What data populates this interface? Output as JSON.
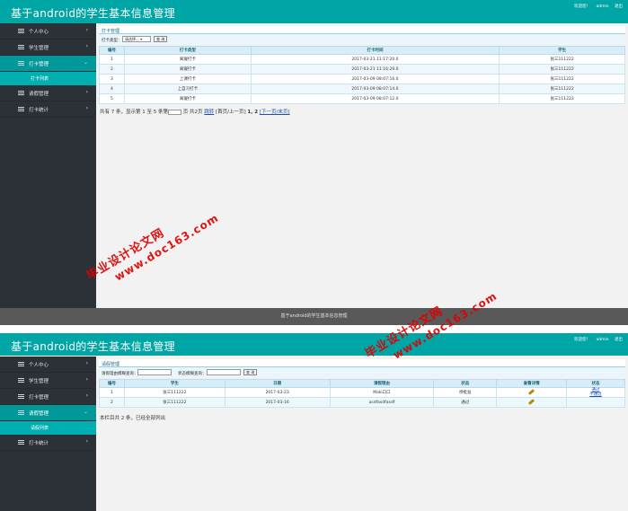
{
  "app_title": "基于android的学生基本信息管理",
  "header_links": {
    "greeting": "欢迎您！",
    "username": "admin",
    "logout": "退出"
  },
  "footer_text": "基于android的学生基本信息管理",
  "screen1": {
    "sidebar": {
      "items": [
        {
          "label": "个人中心",
          "arrow": "›"
        },
        {
          "label": "学生管理",
          "arrow": "›"
        },
        {
          "label": "打卡管理",
          "arrow": "⌄"
        },
        {
          "label": "请假管理",
          "arrow": "›"
        },
        {
          "label": "打卡统计",
          "arrow": "›"
        }
      ],
      "sub_item": "打卡列表"
    },
    "panel_title": "打卡管理",
    "filter": {
      "label": "打卡类型：",
      "select_value": "请选择...",
      "search_button": "查 询"
    },
    "table": {
      "headers": [
        "编号",
        "打卡类型",
        "打卡时间",
        "学生"
      ],
      "rows": [
        [
          "1",
          "离寝打卡",
          "2017-03-21 11:17:20.0",
          "张三111222"
        ],
        [
          "2",
          "离寝打卡",
          "2017-03-21 11:16:29.0",
          "张三111222"
        ],
        [
          "3",
          "上课打卡",
          "2017-03-09 08:07:16.0",
          "张三111222"
        ],
        [
          "4",
          "上自习打卡",
          "2017-03-09 08:07:14.0",
          "张三111222"
        ],
        [
          "5",
          "离寝打卡",
          "2017-03-09 08:07:12.0",
          "张三111222"
        ]
      ]
    },
    "pager": {
      "summary": "共有 7 条，显示第 1 至 5 条第",
      "page_suffix": "页 共2页",
      "jump": "跳转",
      "nav": "[首页/上一页]",
      "pages": "1, 2",
      "next": "[下一页/末页]"
    }
  },
  "screen2": {
    "sidebar": {
      "items": [
        {
          "label": "个人中心",
          "arrow": "›"
        },
        {
          "label": "学生管理",
          "arrow": "›"
        },
        {
          "label": "打卡管理",
          "arrow": "›"
        },
        {
          "label": "请假管理",
          "arrow": "⌄"
        },
        {
          "label": "打卡统计",
          "arrow": "›"
        }
      ],
      "sub_item": "请假列表"
    },
    "panel_title": "请假管理",
    "filter": {
      "label1": "请假理由模糊查询：",
      "label2": "状态模糊查询：",
      "search_button": "查 询"
    },
    "table": {
      "headers": [
        "编号",
        "学生",
        "日期",
        "请假理由",
        "状态",
        "查看详情",
        "状态"
      ],
      "rows": [
        {
          "no": "1",
          "student": "张三111222",
          "date": "2017-03-23",
          "reason": "Maki口口",
          "status": "待批准",
          "actions": [
            "通过",
            "不通过"
          ]
        },
        {
          "no": "2",
          "student": "张三111222",
          "date": "2017-03-16",
          "reason": "asdfasdfasdf",
          "status": "通过",
          "actions": []
        }
      ]
    },
    "summary": "本栏目共 2 条，已经全部列出"
  },
  "watermarks": [
    {
      "cn": "毕业设计论文网",
      "url": "www.doc163.com"
    },
    {
      "cn": "毕业设计论文网",
      "url": "www.doc163.com"
    }
  ]
}
